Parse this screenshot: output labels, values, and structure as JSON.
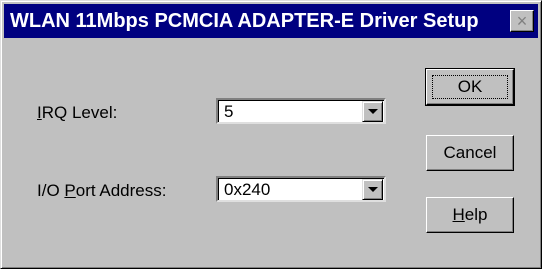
{
  "window": {
    "title": "WLAN 11Mbps PCMCIA ADAPTER-E Driver Setup",
    "close_glyph": "×"
  },
  "fields": {
    "irq": {
      "label_mnemonic": "I",
      "label_rest": "RQ Level:",
      "value": "5"
    },
    "io_port": {
      "label_prefix": "I/O ",
      "label_mnemonic": "P",
      "label_rest": "ort Address:",
      "value": "0x240"
    }
  },
  "buttons": {
    "ok_label": "OK",
    "cancel_label": "Cancel",
    "help_mnemonic": "H",
    "help_rest": "elp"
  },
  "icons": {
    "dropdown": "chevron-down-icon",
    "close": "close-icon"
  }
}
